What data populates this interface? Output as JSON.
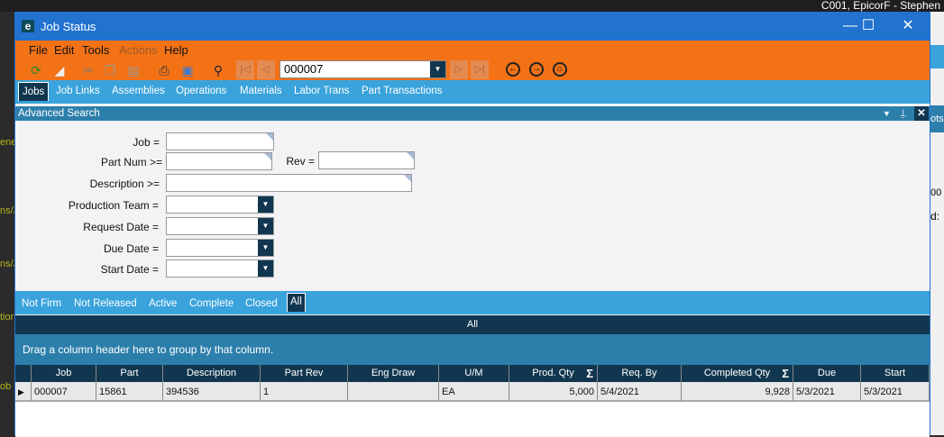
{
  "desktop": {
    "top_title": "C001, EpicorF - Stephen",
    "fragments": [
      "ene",
      "ns/J",
      "ns/J",
      "tion",
      "ob"
    ],
    "right_fragments": [
      "ots",
      "00",
      "d:"
    ]
  },
  "window": {
    "title": "Job Status",
    "minimize": "—",
    "maximize": "☐",
    "close": "✕"
  },
  "menu": [
    "File",
    "Edit",
    "Tools",
    "Actions",
    "Help"
  ],
  "toolbar": {
    "record_value": "000007"
  },
  "tabs": [
    "Jobs",
    "Job Links",
    "Assemblies",
    "Operations",
    "Materials",
    "Labor Trans",
    "Part Transactions"
  ],
  "advanced_search": {
    "title": "Advanced Search",
    "fields": {
      "job": "Job =",
      "part_num": "Part Num >=",
      "rev": "Rev =",
      "description": "Description >=",
      "production_team": "Production Team =",
      "request_date": "Request Date =",
      "due_date": "Due Date =",
      "start_date": "Start Date ="
    }
  },
  "status_tabs": [
    "Not Firm",
    "Not Released",
    "Active",
    "Complete",
    "Closed",
    "All"
  ],
  "grid": {
    "title": "All",
    "group_hint": "Drag a column header here to group by that column.",
    "columns": [
      "Job",
      "Part",
      "Description",
      "Part Rev",
      "Eng Draw",
      "U/M",
      "Prod. Qty",
      "Req. By",
      "Completed Qty",
      "Due",
      "Start"
    ],
    "rows": [
      [
        "000007",
        "15861",
        "394536",
        "1",
        "",
        "EA",
        "5,000",
        "5/4/2021",
        "9,928",
        "5/3/2021",
        "5/3/2021"
      ]
    ]
  }
}
